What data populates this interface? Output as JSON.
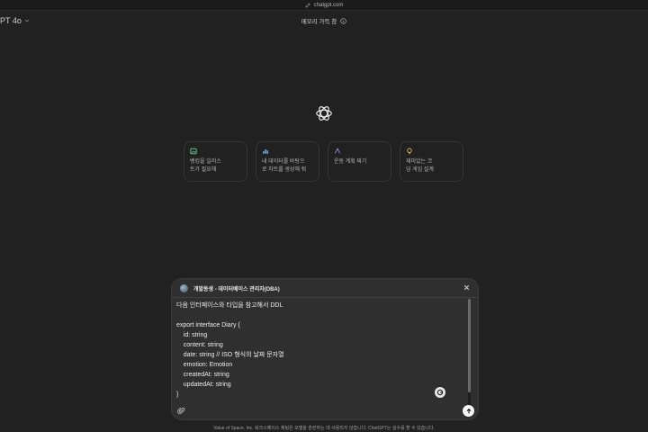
{
  "browser": {
    "url": "chatgpt.com",
    "url_icon": "link-icon"
  },
  "header": {
    "model_label": "PT 4o",
    "memory_label": "메모리 가득 참",
    "memory_icon": "info-icon"
  },
  "logo": {
    "icon": "openai-logo-icon"
  },
  "suggestions": [
    {
      "icon": "image-icon",
      "color": "#6fd0a6",
      "line1": "벵킹을 일러스",
      "line2": "트가 필요해"
    },
    {
      "icon": "chart-icon",
      "color": "#6fb6e8",
      "line1": "내 데이터를 바탕으",
      "line2": "로 차트를 생성해 줘"
    },
    {
      "icon": "plan-icon",
      "color": "#c58be0",
      "line1": "운동 계획 짜기",
      "line2": ""
    },
    {
      "icon": "bulb-icon",
      "color": "#e8d06a",
      "line1": "재미있는 코",
      "line2": "딩 게임 설계"
    }
  ],
  "composer": {
    "context_title": "개발동생 - 데이터베이스 관리자(DBA)",
    "message": "다음 인터페이스와 타입을 참고해서 DDL\n\nexport interface Diary {\n    id: string\n    content: string\n    date: string // ISO 형식의 날짜 문자열\n    emotion: Emotion\n    createdAt: string\n    updatedAt: string\n}"
  },
  "footer": {
    "disclaimer": "Value of Space, Inc. 워크스페이스 채팅은 모델을 훈련하는 데 사용되지 않습니다. ChatGPT는 실수를 할 수 있습니다."
  }
}
